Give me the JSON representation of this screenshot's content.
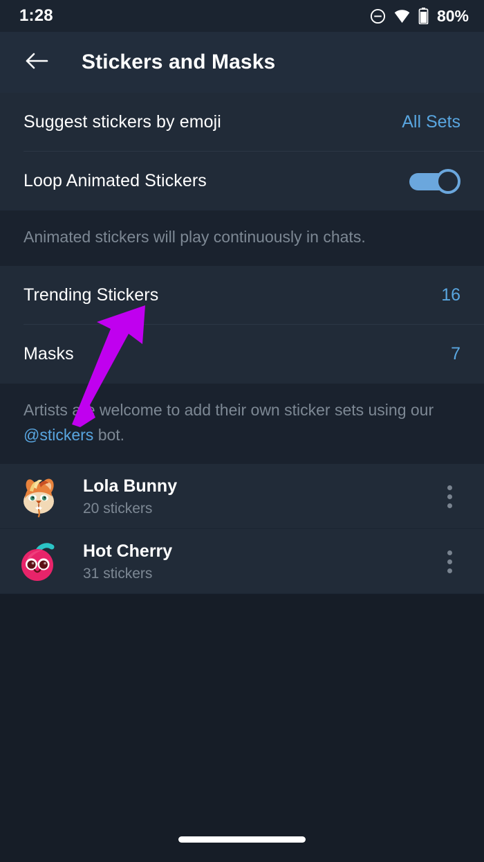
{
  "status_bar": {
    "time": "1:28",
    "battery_percent": "80%",
    "icons": [
      "do-not-disturb-icon",
      "wifi-icon",
      "battery-icon"
    ]
  },
  "app_bar": {
    "back_icon": "back-arrow-icon",
    "title": "Stickers and Masks"
  },
  "settings": {
    "suggest": {
      "label": "Suggest stickers by emoji",
      "value": "All Sets"
    },
    "loop": {
      "label": "Loop Animated Stickers",
      "toggle_on": true
    },
    "loop_hint": "Animated stickers will play continuously in chats."
  },
  "counts": {
    "trending": {
      "label": "Trending Stickers",
      "value": "16"
    },
    "masks": {
      "label": "Masks",
      "value": "7"
    }
  },
  "artists_hint": {
    "text_before": "Artists are welcome to add their own sticker sets using our ",
    "link": "@stickers",
    "text_after": " bot."
  },
  "sticker_sets": [
    {
      "title": "Lola Bunny",
      "subtitle": "20 stickers",
      "thumb": "lola-bunny-sticker-icon",
      "menu_icon": "overflow-menu-icon"
    },
    {
      "title": "Hot Cherry",
      "subtitle": "31 stickers",
      "thumb": "hot-cherry-sticker-icon",
      "menu_icon": "overflow-menu-icon"
    }
  ],
  "annotation": {
    "type": "arrow",
    "color": "#c000ef",
    "points_to": "Trending Stickers"
  },
  "colors": {
    "page_background": "#161d27",
    "card_background": "#212b38",
    "gap_background": "#1a222e",
    "app_bar": "#222d3c",
    "status_bar": "#1b2430",
    "accent_blue": "#59a6e0",
    "muted_text": "#7d8894"
  },
  "nav": {
    "gesture_pill": "home-gesture-pill"
  }
}
